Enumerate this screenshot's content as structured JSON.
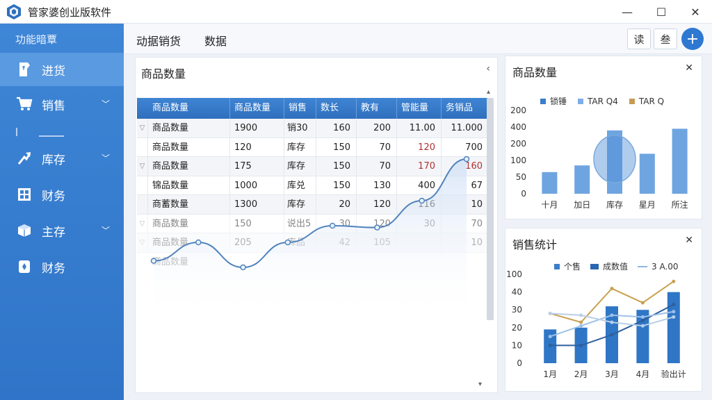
{
  "window": {
    "title": "管家婆创业版软件",
    "minimize": "—",
    "maximize": "☐",
    "close": "✕"
  },
  "sidebar": {
    "title": "功能暗覃",
    "items": [
      {
        "label": "进货",
        "icon": "tag-icon",
        "expandable": false,
        "active": true
      },
      {
        "label": "销售",
        "icon": "cart-icon",
        "expandable": true,
        "active": false
      },
      {
        "label": "库存",
        "icon": "arrow-icon",
        "expandable": true,
        "active": false
      },
      {
        "label": "财务",
        "icon": "grid-icon",
        "expandable": false,
        "active": false
      },
      {
        "label": "主存",
        "icon": "box-icon",
        "expandable": true,
        "active": false
      },
      {
        "label": "财务",
        "icon": "wallet-icon",
        "expandable": false,
        "active": false
      }
    ]
  },
  "toolbar": {
    "tabs": [
      "动据销货",
      "数据"
    ],
    "buttons": [
      "读",
      "叁"
    ],
    "add": "+"
  },
  "main": {
    "title": "商品数量",
    "collapse": "‹",
    "columns": [
      "商品数量",
      "商品数量",
      "销售",
      "数长",
      "教有",
      "管能量",
      "务销品"
    ],
    "rows": [
      {
        "marker": "▽",
        "cells": [
          "商品数量",
          "1900",
          "销30",
          "160",
          "200",
          "11.00",
          "11.000"
        ]
      },
      {
        "marker": "",
        "cells": [
          "商品数量",
          "120",
          "库存",
          "150",
          "70",
          "120",
          "700"
        ]
      },
      {
        "marker": "▽",
        "cells": [
          "商品数量",
          "175",
          "库存",
          "150",
          "70",
          "170",
          "160"
        ]
      },
      {
        "marker": "",
        "cells": [
          "锦品数量",
          "1000",
          "库兑",
          "150",
          "130",
          "400",
          "67"
        ]
      },
      {
        "marker": "",
        "cells": [
          "商蓄数量",
          "1300",
          "库存",
          "20",
          "120",
          "116",
          "10"
        ]
      },
      {
        "marker": "▽",
        "cells": [
          "商品数量",
          "150",
          "说出5",
          "30",
          "120",
          "30",
          "70"
        ]
      },
      {
        "marker": "▽",
        "cells": [
          "商品数量",
          "205",
          "库品",
          "42",
          "105",
          "",
          "10"
        ]
      },
      {
        "marker": "",
        "cells": [
          "商品数量",
          "",
          "",
          "",
          "",
          "",
          ""
        ]
      }
    ],
    "scroll_up": "▴",
    "scroll_down": "▾",
    "trend": [
      10,
      30,
      3,
      30,
      48,
      46,
      75,
      120
    ]
  },
  "card1": {
    "title": "商品数量",
    "close": "✕",
    "legend": [
      {
        "label": "锁锤",
        "color": "#3b7dc9",
        "kind": "box"
      },
      {
        "label": "TAR Q4",
        "color": "#7eaee6",
        "kind": "box"
      },
      {
        "label": "TAR Q",
        "color": "#c79a55",
        "kind": "box"
      }
    ],
    "chart_data": {
      "type": "bar",
      "categories": [
        "十月",
        "加日",
        "库存",
        "星月",
        "所注"
      ],
      "values": [
        65,
        85,
        190,
        120,
        195
      ],
      "yticks": [
        "0",
        "50",
        "100",
        "200",
        "400",
        "200"
      ],
      "ylim": [
        0,
        250
      ],
      "color": "#6ea5e0",
      "highlight_index": 2,
      "highlight_color": "#4f8fd6"
    }
  },
  "card2": {
    "title": "销售统计",
    "close": "✕",
    "legend": [
      {
        "label": "个售",
        "color": "#3b7dc9",
        "kind": "box"
      },
      {
        "label": "成数值",
        "color": "#2b66b0",
        "kind": "wide"
      },
      {
        "label": "3 A.00",
        "color": "#8db6e4",
        "kind": "line"
      }
    ],
    "chart_data": {
      "type": "bar",
      "categories": [
        "1月",
        "2月",
        "3月",
        "4月",
        "验出计"
      ],
      "bars": [
        19,
        20,
        32,
        30,
        40
      ],
      "yticks": [
        "0",
        "10",
        "20",
        "30",
        "40",
        "100"
      ],
      "ylim": [
        0,
        50
      ],
      "series": [
        {
          "values": [
            10,
            10,
            16,
            24,
            33
          ],
          "color": "#2d5f9e"
        },
        {
          "values": [
            28,
            23,
            42,
            34,
            46
          ],
          "color": "#c9a050"
        },
        {
          "values": [
            15,
            21,
            27,
            26,
            29
          ],
          "color": "#9ec0e8"
        },
        {
          "values": [
            28,
            27,
            23,
            21,
            26
          ],
          "color": "#b9cfe8"
        }
      ],
      "bar_color": "#2f76c6"
    }
  }
}
